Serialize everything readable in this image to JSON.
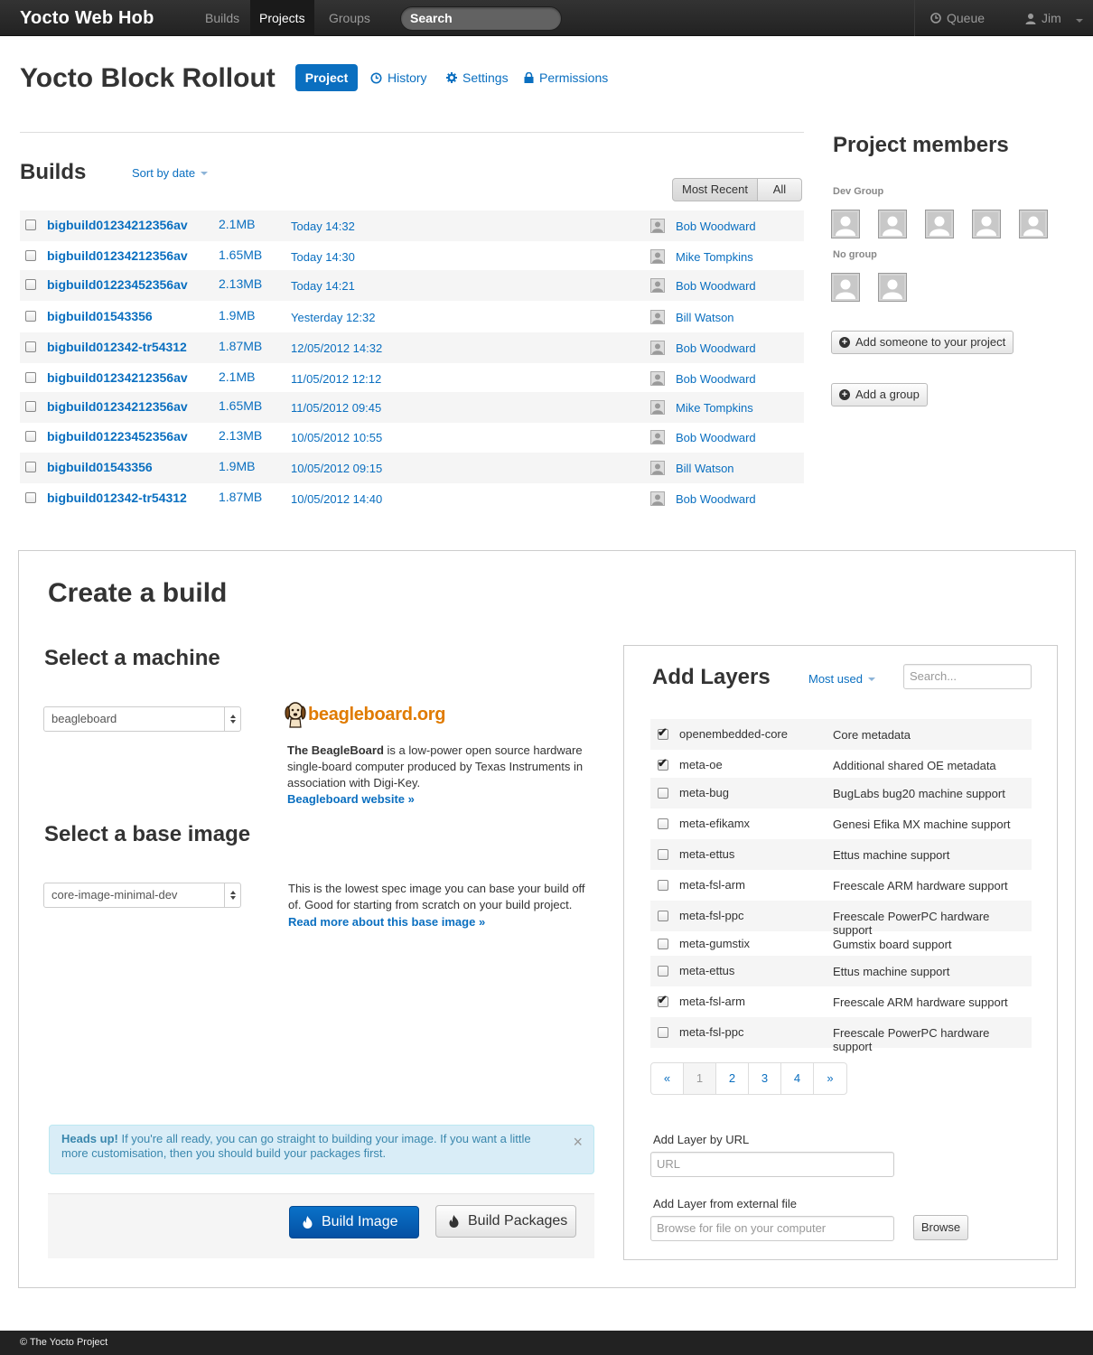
{
  "navbar": {
    "brand": "Yocto Web Hob",
    "items": [
      {
        "label": "Builds",
        "active": false
      },
      {
        "label": "Projects",
        "active": true
      },
      {
        "label": "Groups",
        "active": false
      }
    ],
    "search_placeholder": "Search",
    "queue_label": "Queue",
    "user_label": "Jim"
  },
  "project": {
    "title": "Yocto Block Rollout",
    "tabs": [
      {
        "label": "Project",
        "icon": "none",
        "active": true
      },
      {
        "label": "History",
        "icon": "clock-icon"
      },
      {
        "label": "Settings",
        "icon": "gear-icon"
      },
      {
        "label": "Permissions",
        "icon": "lock-icon"
      }
    ]
  },
  "builds": {
    "title": "Builds",
    "sort_label": "Sort by date",
    "filters": [
      "Most Recent",
      "All"
    ],
    "rows": [
      {
        "name": "bigbuild01234212356av",
        "size": "2.1MB",
        "date": "Today 14:32",
        "user": "Bob Woodward"
      },
      {
        "name": "bigbuild01234212356av",
        "size": "1.65MB",
        "date": "Today 14:30",
        "user": "Mike Tompkins"
      },
      {
        "name": "bigbuild01223452356av",
        "size": "2.13MB",
        "date": "Today 14:21",
        "user": "Bob Woodward"
      },
      {
        "name": "bigbuild01543356",
        "size": "1.9MB",
        "date": "Yesterday 12:32",
        "user": "Bill Watson"
      },
      {
        "name": "bigbuild012342-tr54312",
        "size": "1.87MB",
        "date": "12/05/2012 14:32",
        "user": "Bob Woodward"
      },
      {
        "name": "bigbuild01234212356av",
        "size": "2.1MB",
        "date": "11/05/2012 12:12",
        "user": "Bob Woodward"
      },
      {
        "name": "bigbuild01234212356av",
        "size": "1.65MB",
        "date": "11/05/2012 09:45",
        "user": "Mike Tompkins"
      },
      {
        "name": "bigbuild01223452356av",
        "size": "2.13MB",
        "date": "10/05/2012 10:55",
        "user": "Bob Woodward"
      },
      {
        "name": "bigbuild01543356",
        "size": "1.9MB",
        "date": "10/05/2012 09:15",
        "user": "Bill Watson"
      },
      {
        "name": "bigbuild012342-tr54312",
        "size": "1.87MB",
        "date": "10/05/2012 14:40",
        "user": "Bob Woodward"
      }
    ]
  },
  "members": {
    "title": "Project members",
    "groups": [
      {
        "label": "Dev Group",
        "count": 5
      },
      {
        "label": "No group",
        "count": 2
      }
    ],
    "add_person_label": "Add someone to your project",
    "add_group_label": "Add a group"
  },
  "create_build": {
    "title": "Create a build",
    "machine": {
      "heading": "Select a machine",
      "selected": "beagleboard",
      "logo_text": "beagleboard.org",
      "desc_bold": "The BeagleBoard",
      "desc_rest": " is a low-power open source hardware single-board computer produced by Texas Instruments in association with Digi-Key.",
      "link": "Beagleboard website »"
    },
    "image": {
      "heading": "Select a base image",
      "selected": "core-image-minimal-dev",
      "desc": "This is the lowest spec image you can base your build off of. Good for starting from scratch on your build project.",
      "link": "Read more about this base image »"
    },
    "alert": {
      "strong": "Heads up!",
      "text": " If you're all ready, you can go straight to building your image. If you want a little more customisation, then you should build your packages first.",
      "close": "×"
    },
    "build_image_label": "Build Image",
    "build_packages_label": "Build Packages"
  },
  "layers": {
    "title": "Add Layers",
    "sort_label": "Most used",
    "search_placeholder": "Search...",
    "rows": [
      {
        "name": "openembedded-core",
        "desc": "Core metadata",
        "checked": true
      },
      {
        "name": "meta-oe",
        "desc": "Additional shared OE metadata",
        "checked": true
      },
      {
        "name": "meta-bug",
        "desc": "BugLabs bug20 machine support",
        "checked": false
      },
      {
        "name": "meta-efikamx",
        "desc": "Genesi Efika MX machine support",
        "checked": false
      },
      {
        "name": "meta-ettus",
        "desc": "Ettus machine support",
        "checked": false
      },
      {
        "name": "meta-fsl-arm",
        "desc": "Freescale ARM hardware support",
        "checked": false
      },
      {
        "name": "meta-fsl-ppc",
        "desc": "Freescale PowerPC hardware support",
        "checked": false
      },
      {
        "name": "meta-gumstix",
        "desc": "Gumstix board support",
        "checked": false
      },
      {
        "name": "meta-ettus",
        "desc": "Ettus machine support",
        "checked": false
      },
      {
        "name": "meta-fsl-arm",
        "desc": "Freescale ARM hardware support",
        "checked": true
      },
      {
        "name": "meta-fsl-ppc",
        "desc": "Freescale PowerPC hardware support",
        "checked": false
      }
    ],
    "pagination": [
      "«",
      "1",
      "2",
      "3",
      "4",
      "»"
    ],
    "pagination_active": "1",
    "url_label": "Add Layer by URL",
    "url_placeholder": "URL",
    "file_label": "Add Layer from external file",
    "file_placeholder": "Browse for file on your computer",
    "browse_label": "Browse"
  },
  "footer": {
    "text": "© The Yocto Project"
  },
  "colors": {
    "link": "#0a6fc0",
    "navbar": "#222222",
    "primary": "#0450a3",
    "alert_bg": "#d9edf7"
  }
}
